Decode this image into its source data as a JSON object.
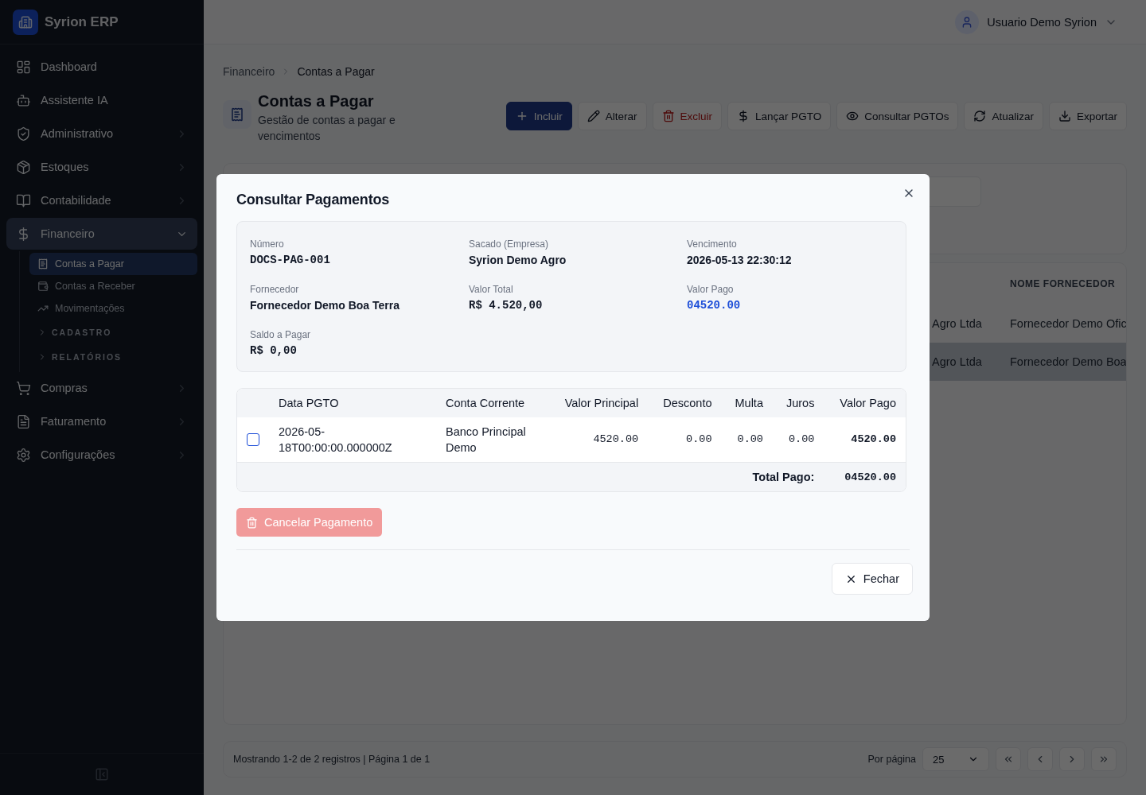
{
  "app": {
    "name": "Syrion ERP"
  },
  "sidebar": {
    "items": [
      {
        "label": "Dashboard",
        "selected": false
      },
      {
        "label": "Assistente IA",
        "selected": false
      },
      {
        "label": "Administrativo",
        "selected": false,
        "expanded": false
      },
      {
        "label": "Estoques",
        "selected": false,
        "expanded": false
      },
      {
        "label": "Contabilidade",
        "selected": false,
        "expanded": false
      },
      {
        "label": "Financeiro",
        "selected": true,
        "expanded": true,
        "children": [
          {
            "label": "Contas a Pagar",
            "kind": "link",
            "selected": true
          },
          {
            "label": "Contas a Receber",
            "kind": "link",
            "selected": false
          },
          {
            "label": "Movimentações",
            "kind": "link",
            "selected": false
          },
          {
            "label": "CADASTRO",
            "kind": "section",
            "selected": false
          },
          {
            "label": "RELATÓRIOS",
            "kind": "section",
            "selected": false
          }
        ]
      },
      {
        "label": "Compras",
        "selected": false,
        "expanded": false
      },
      {
        "label": "Faturamento",
        "selected": false,
        "expanded": false
      },
      {
        "label": "Configurações",
        "selected": false,
        "expanded": false
      }
    ]
  },
  "topbar": {
    "user": "Usuario Demo Syrion"
  },
  "breadcrumb": [
    "Financeiro",
    "Contas a Pagar"
  ],
  "page": {
    "title": "Contas a Pagar",
    "subtitle": "Gestão de contas a pagar e vencimentos"
  },
  "toolbar": [
    {
      "label": "Incluir",
      "kind": "primary"
    },
    {
      "label": "Alterar",
      "kind": "default"
    },
    {
      "label": "Excluir",
      "kind": "danger"
    },
    {
      "label": "Lançar PGTO",
      "kind": "default"
    },
    {
      "label": "Consultar PGTOs",
      "kind": "default"
    },
    {
      "label": "Atualizar",
      "kind": "default"
    },
    {
      "label": "Exportar",
      "kind": "default"
    }
  ],
  "table": {
    "columns": [
      "",
      "NOME FORNECEDOR"
    ],
    "rows": [
      {
        "cells": [
          "Agro Ltda",
          "Fornecedor Demo Ofic"
        ],
        "selected": false
      },
      {
        "cells": [
          "Agro Ltda",
          "Fornecedor Demo Boa"
        ],
        "selected": true
      }
    ]
  },
  "pagination": {
    "summary": "Mostrando 1-2 de 2 registros | Página 1 de 1",
    "per_page_label": "Por página",
    "per_page": "25"
  },
  "modal": {
    "title": "Consultar Pagamentos",
    "fields": [
      {
        "label": "Número",
        "value": "DOCS-PAG-001",
        "kind": "mono"
      },
      {
        "label": "Sacado (Empresa)",
        "value": "Syrion Demo Agro",
        "kind": "text"
      },
      {
        "label": "Vencimento",
        "value": "2026-05-13 22:30:12",
        "kind": "text"
      },
      {
        "label": "Fornecedor",
        "value": "Fornecedor Demo Boa Terra",
        "kind": "text"
      },
      {
        "label": "Valor Total",
        "value": "R$ 4.520,00",
        "kind": "mono"
      },
      {
        "label": "Valor Pago",
        "value": "04520.00",
        "kind": "highlight"
      },
      {
        "label": "Saldo a Pagar",
        "value": "R$ 0,00",
        "kind": "mono"
      }
    ],
    "payments": {
      "columns": [
        "Data PGTO",
        "Conta Corrente",
        "Valor Principal",
        "Desconto",
        "Multa",
        "Juros",
        "Valor Pago"
      ],
      "rows": [
        {
          "checked": false,
          "cells": [
            "2026-05-18T00:00:00.000000Z",
            "Banco Principal Demo",
            "4520.00",
            "0.00",
            "0.00",
            "0.00",
            "4520.00"
          ]
        }
      ],
      "total_label": "Total Pago:",
      "total": "04520.00"
    },
    "cancel_button": {
      "label": "Cancelar Pagamento",
      "disabled": true
    },
    "close_button": {
      "label": "Fechar"
    }
  }
}
